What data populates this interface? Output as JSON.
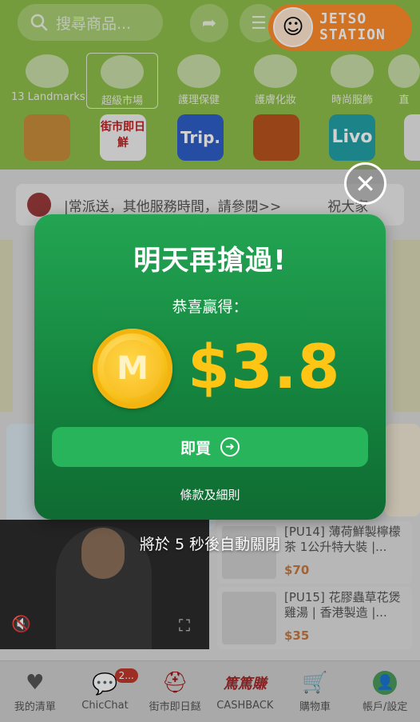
{
  "header": {
    "search_placeholder": "搜尋商品...",
    "watermark_line1": "JETSO",
    "watermark_line2": "STATION"
  },
  "categories": [
    {
      "label": "13 Landmarks"
    },
    {
      "label": "超級市場"
    },
    {
      "label": "護理保健"
    },
    {
      "label": "護膚化妝"
    },
    {
      "label": "時尚服飾"
    },
    {
      "label": "直"
    }
  ],
  "tiles": [
    {
      "label": "",
      "color": "#c98d3b"
    },
    {
      "label": "街市即日鮮",
      "color": "#f1f1f1"
    },
    {
      "label": "Trip.",
      "color": "#2c5fc7"
    },
    {
      "label": "",
      "color": "#b9541f"
    },
    {
      "label": "Livo",
      "color": "#23a2a6"
    },
    {
      "label": "",
      "color": "#e9e9e9"
    }
  ],
  "notice": {
    "text": "|常派送，其他服務時間，請參閱>>",
    "tail": "祝大家"
  },
  "modal": {
    "title": "明天再搶過!",
    "subtitle": "恭喜贏得：",
    "coin_letter": "M",
    "amount": "$3.8",
    "buy_label": "即買",
    "terms_label": "條款及細則",
    "close_symbol": "✕"
  },
  "countdown": "將於 5 秒後自動關閉",
  "products": [
    {
      "name": "[PU14] 薄荷鮮製檸檬茶 1公升特大裝 |...",
      "price": "$70"
    },
    {
      "name": "[PU15] 花膠蟲草花煲雞湯 | 香港製造 |...",
      "price": "$35"
    }
  ],
  "tabbar": [
    {
      "label": "我的清單",
      "icon": "heart-icon",
      "glyph": "♥"
    },
    {
      "label": "ChicChat",
      "icon": "chat-icon",
      "glyph": "💬",
      "badge": "2..."
    },
    {
      "label": "街市即日餸",
      "icon": "market-icon",
      "glyph": "⛑"
    },
    {
      "label": "CASHBACK",
      "icon": "cashback-icon",
      "glyph": "篤篤賺"
    },
    {
      "label": "購物車",
      "icon": "cart-icon",
      "glyph": "🛒"
    },
    {
      "label": "帳戶/設定",
      "icon": "account-icon",
      "glyph": "👤"
    }
  ],
  "colors": {
    "modal_green": "#15853f",
    "amount_gold": "#ffc514",
    "button_green": "#27b45b"
  }
}
